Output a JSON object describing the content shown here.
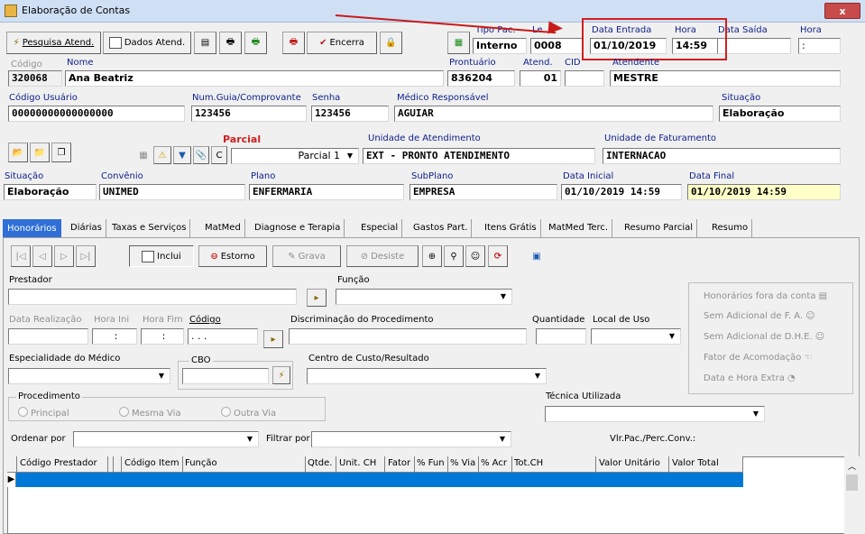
{
  "window": {
    "title": "Elaboração de Contas",
    "close": "x"
  },
  "toolbar": {
    "pesquisa_atend": "Pesquisa Atend.",
    "dados_atend": "Dados Atend.",
    "encerra": "Encerra"
  },
  "header": {
    "tipo_pac_label": "Tipo Pac.",
    "tipo_pac": "Interno",
    "leito_label": "Le",
    "leito": "0008",
    "data_entrada_label": "Data Entrada",
    "data_entrada": "01/10/2019",
    "hora_label": "Hora",
    "hora": "14:59",
    "data_saida_label": "Data Saída",
    "data_saida": "",
    "hora2_label": "Hora",
    "hora2": ":",
    "codigo_label": "Código",
    "codigo": "320068",
    "nome_label": "Nome",
    "nome": "Ana Beatriz",
    "prontuario_label": "Prontuário",
    "prontuario": "836204",
    "atend_label": "Atend.",
    "atend": "01",
    "cid_label": "CID",
    "cid": "",
    "atendente_label": "Atendente",
    "atendente": "MESTRE",
    "codigo_usuario_label": "Código Usuário",
    "codigo_usuario": "00000000000000000",
    "num_guia_label": "Num.Guia/Comprovante",
    "num_guia": "123456",
    "senha_label": "Senha",
    "senha": "123456",
    "medico_label": "Médico Responsável",
    "medico": "AGUIAR",
    "situacao_label": "Situação",
    "situacao": "Elaboração"
  },
  "parcial": {
    "title": "Parcial",
    "c_label": "C",
    "parcial_value": "Parcial 1",
    "unidade_atend_label": "Unidade de Atendimento",
    "unidade_atend": "EXT - PRONTO ATENDIMENTO",
    "unidade_fat_label": "Unidade de Faturamento",
    "unidade_fat": "INTERNACAO",
    "situacao_label": "Situação",
    "situacao": "Elaboração",
    "convenio_label": "Convênio",
    "convenio": "UNIMED",
    "plano_label": "Plano",
    "plano": "ENFERMARIA",
    "subplano_label": "SubPlano",
    "subplano": "EMPRESA",
    "data_inicial_label": "Data Inicial",
    "data_inicial": "01/10/2019 14:59",
    "data_final_label": "Data Final",
    "data_final": "01/10/2019 14:59"
  },
  "tabs": [
    "Honorários",
    "Diárias",
    "Taxas e Serviços",
    "MatMed",
    "Diagnose e Terapia",
    "Especial",
    "Gastos Part.",
    "Itens Grátis",
    "MatMed Terc.",
    "Resumo Parcial",
    "Resumo"
  ],
  "actions": {
    "inclui": "Inclui",
    "estorno": "Estorno",
    "grava": "Grava",
    "desiste": "Desiste"
  },
  "form": {
    "prestador_label": "Prestador",
    "funcao_label": "Função",
    "data_realizacao_label": "Data Realização",
    "hora_ini_label": "Hora Ini",
    "hora_fim_label": "Hora Fim",
    "codigo_label": "Código",
    "codigo_value": ". . .",
    "hora_ini_value": ":",
    "hora_fim_value": ":",
    "discriminacao_label": "Discriminação do Procedimento",
    "quantidade_label": "Quantidade",
    "local_uso_label": "Local de Uso",
    "especialidade_label": "Especialidade do Médico",
    "cbo_label": "CBO",
    "centro_custo_label": "Centro de Custo/Resultado",
    "procedimento_label": "Procedimento",
    "principal": "Principal",
    "mesma_via": "Mesma Via",
    "outra_via": "Outra Via",
    "tecnica_label": "Técnica Utilizada",
    "ordenar_label": "Ordenar por",
    "filtrar_label": "Filtrar por",
    "vlr_label": "Vlr.Pac./Perc.Conv.:"
  },
  "side": {
    "items": [
      "Honorários fora da conta",
      "Sem Adicional de F. A.",
      "Sem Adicional de D.H.E.",
      "Fator de Acomodação",
      "Data e Hora Extra"
    ]
  },
  "grid": {
    "columns": [
      "Código Prestador",
      "Código Item",
      "Função",
      "Qtde.",
      "Unit. CH",
      "Fator",
      "% Fun",
      "% Via",
      "% Acr",
      "Tot.CH",
      "Valor Unitário",
      "Valor Total"
    ]
  },
  "colors": {
    "accent": "#2f6fd6",
    "selection": "#0078d7",
    "highlight": "#d21f1f",
    "label": "#0b1e8a"
  }
}
